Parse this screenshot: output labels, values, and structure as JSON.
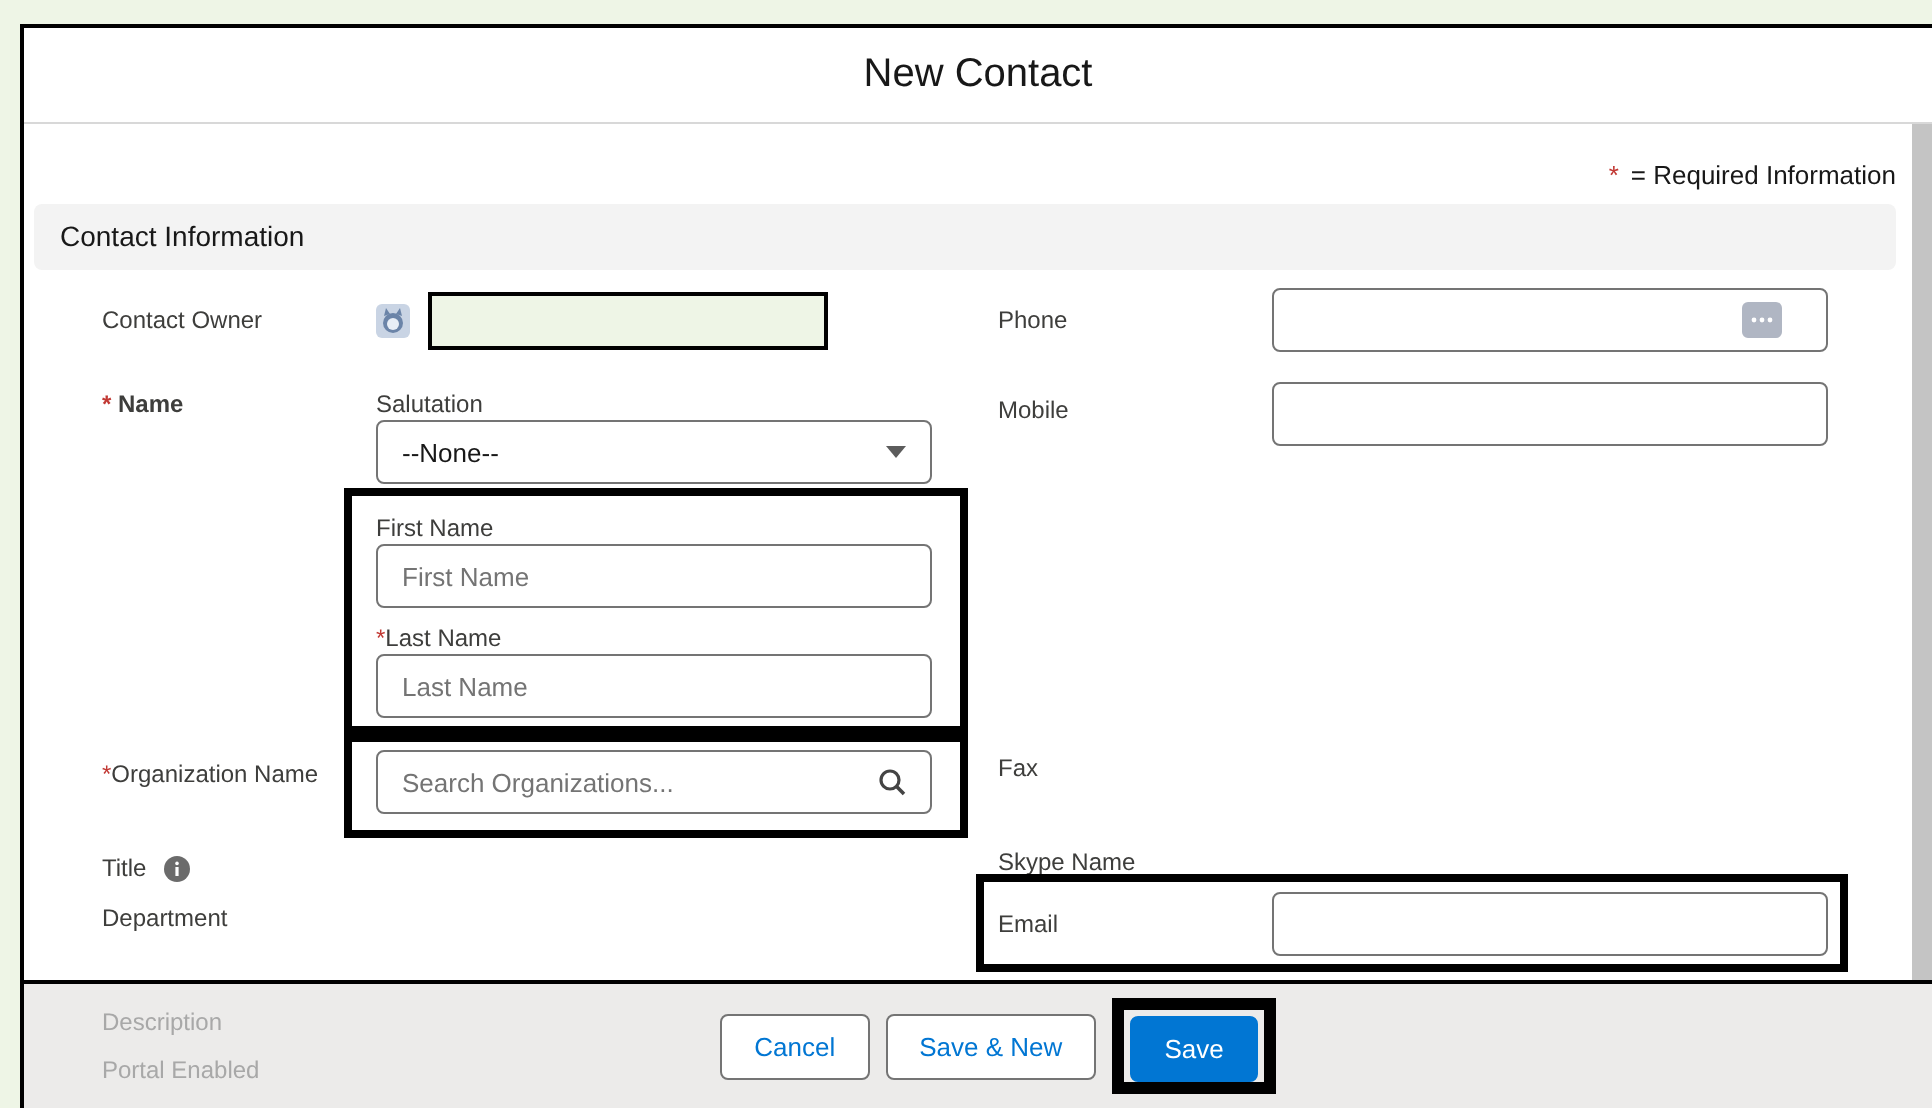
{
  "dialog": {
    "title": "New Contact"
  },
  "required_note": {
    "mark": "*",
    "text": "= Required Information"
  },
  "section": {
    "title": "Contact Information"
  },
  "contact_owner": {
    "label": "Contact Owner",
    "highlighted": true
  },
  "name": {
    "label": "Name",
    "required": true,
    "salutation": {
      "label": "Salutation",
      "value": "--None--"
    },
    "highlighted": true,
    "first_name": {
      "label": "First Name",
      "placeholder": "First Name"
    },
    "last_name": {
      "label": "Last Name",
      "placeholder": "Last Name",
      "required": true
    }
  },
  "organization": {
    "label": "Organization Name",
    "required": true,
    "placeholder": "Search Organizations...",
    "highlighted": true
  },
  "title_field": {
    "label": "Title"
  },
  "department": {
    "label": "Department"
  },
  "phone": {
    "label": "Phone"
  },
  "mobile": {
    "label": "Mobile"
  },
  "fax": {
    "label": "Fax"
  },
  "skype": {
    "label": "Skype Name"
  },
  "email": {
    "label": "Email",
    "highlighted": true
  },
  "hidden_fields": [
    "Description",
    "Portal Enabled"
  ],
  "buttons": [
    {
      "label": "Cancel",
      "kind": "neutral",
      "highlighted": false
    },
    {
      "label": "Save & New",
      "kind": "neutral",
      "highlighted": false
    },
    {
      "label": "Save",
      "kind": "brand",
      "highlighted": true
    }
  ]
}
